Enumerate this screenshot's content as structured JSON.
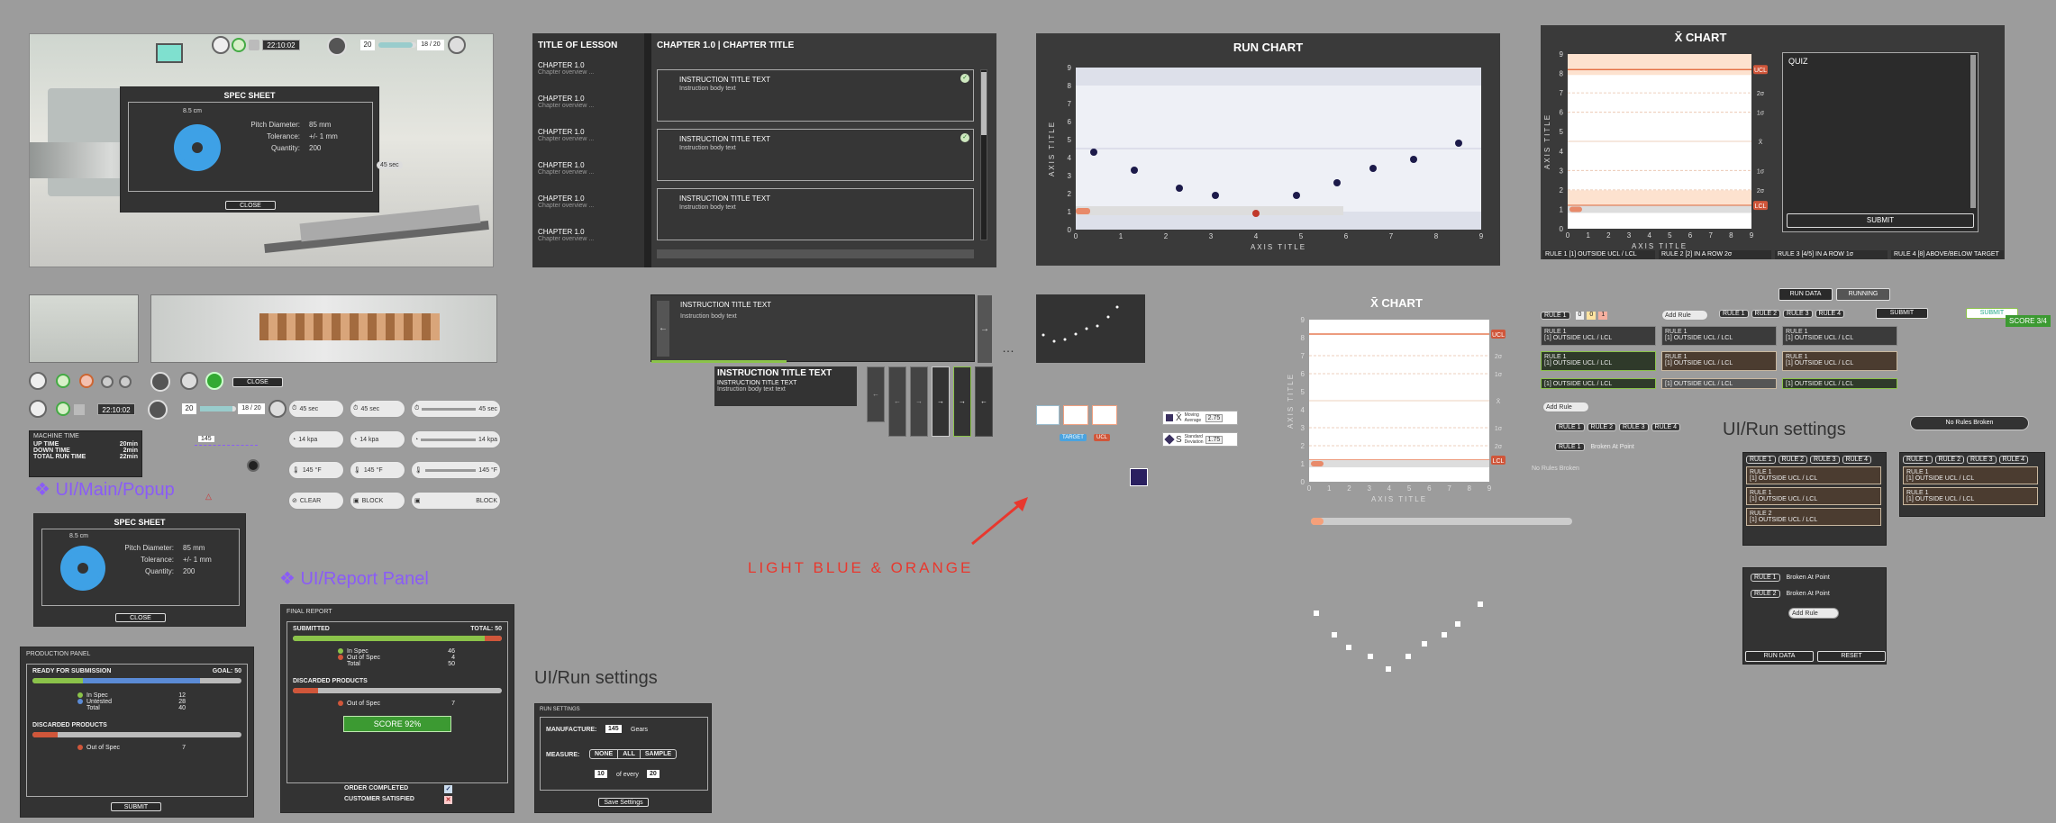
{
  "spec_sheet": {
    "title": "SPEC SHEET",
    "dimension": "8.5 cm",
    "rows": [
      {
        "label": "Pitch Diameter:",
        "value": "85 mm"
      },
      {
        "label": "Tolerance:",
        "value": "+/- 1 mm"
      },
      {
        "label": "Quantity:",
        "value": "200"
      }
    ],
    "close": "CLOSE",
    "badge": "45 sec"
  },
  "top_hud": {
    "time": "22:10:02",
    "count": "20",
    "progress": "18 / 20"
  },
  "lesson": {
    "title": "TITLE OF LESSON",
    "chapter_heading": "CHAPTER 1.0 | CHAPTER TITLE",
    "chapters": [
      {
        "title": "CHAPTER 1.0",
        "sub": "Chapter overview ..."
      },
      {
        "title": "CHAPTER 1.0",
        "sub": "Chapter overview ..."
      },
      {
        "title": "CHAPTER 1.0",
        "sub": "Chapter overview ..."
      },
      {
        "title": "CHAPTER 1.0",
        "sub": "Chapter overview ..."
      },
      {
        "title": "CHAPTER 1.0",
        "sub": "Chapter overview ..."
      },
      {
        "title": "CHAPTER 1.0",
        "sub": "Chapter overview ..."
      }
    ],
    "instructions": [
      {
        "title": "INSTRUCTION TITLE TEXT",
        "body": "Instruction body text",
        "done": true
      },
      {
        "title": "INSTRUCTION TITLE TEXT",
        "body": "Instruction body text",
        "done": true
      },
      {
        "title": "INSTRUCTION TITLE TEXT",
        "body": "Instruction body text",
        "done": false
      }
    ]
  },
  "run_chart": {
    "title": "RUN CHART",
    "xlabel": "AXIS TITLE",
    "ylabel": "AXIS TITLE"
  },
  "xbar_chart": {
    "title": "X̄ CHART",
    "xlabel": "AXIS TITLE",
    "ylabel": "AXIS TITLE",
    "quiz": "QUIZ",
    "submit": "SUBMIT",
    "limits": [
      "UCL",
      "2σ",
      "1σ",
      "X̄",
      "1σ",
      "2σ",
      "LCL"
    ],
    "rules": [
      "RULE 1 [1] OUTSIDE UCL / LCL",
      "RULE 2 [2] IN A ROW 2σ",
      "RULE 3 [4/5] IN A ROW 1σ",
      "RULE 4 [8] ABOVE/BELOW TARGET"
    ]
  },
  "xbar_chart2": {
    "title": "X̄ CHART",
    "xlabel": "AXIS TITLE",
    "ylabel": "AXIS TITLE",
    "limits": [
      "UCL",
      "2σ",
      "1σ",
      "X̄",
      "1σ",
      "2σ",
      "LCL"
    ],
    "no_rules": "No Rules Broken"
  },
  "chart_data": [
    {
      "type": "scatter",
      "title": "RUN CHART",
      "xlabel": "AXIS TITLE",
      "ylabel": "AXIS TITLE",
      "xlim": [
        0,
        9
      ],
      "ylim": [
        0,
        9
      ],
      "x": [
        0.4,
        1.3,
        2.3,
        3.1,
        4,
        4.9,
        5.8,
        6.6,
        7.5,
        8.5
      ],
      "y": [
        4.3,
        3.3,
        2.3,
        1.9,
        0.9,
        1.9,
        2.6,
        3.4,
        3.9,
        4.8
      ]
    },
    {
      "type": "scatter",
      "title": "X̄ CHART",
      "xlabel": "AXIS TITLE",
      "ylabel": "AXIS TITLE",
      "xlim": [
        0,
        9
      ],
      "ylim": [
        0,
        9
      ],
      "x": [],
      "y": []
    }
  ],
  "label_light": "LIGHT BLUE & ORANGE",
  "labels": {
    "main_popup": "❖ UI/Main/Popup",
    "report_panel": "❖ UI/Report Panel",
    "run_settings": "UI/Run settings",
    "run_settings2": "UI/Run settings"
  },
  "machine_time": {
    "title": "MACHINE TIME",
    "rows": [
      {
        "label": "UP TIME",
        "value": "20min"
      },
      {
        "label": "DOWN TIME",
        "value": "2min"
      },
      {
        "label": "TOTAL RUN TIME",
        "value": "22min"
      }
    ]
  },
  "gauges": {
    "time": "45 sec",
    "pressure": "14 kpa",
    "temp": "145 °F",
    "clear": "CLEAR",
    "block": "BLOCK"
  },
  "production": {
    "title": "PRODUCTION PANEL",
    "ready": "READY FOR SUBMISSION",
    "goal": "GOAL: 50",
    "legend": [
      {
        "label": "In Spec",
        "value": "12",
        "color": "#8bc34a"
      },
      {
        "label": "Untested",
        "value": "28",
        "color": "#5b8bd6"
      },
      {
        "label": "Total",
        "value": "40",
        "color": ""
      }
    ],
    "discarded": "DISCARDED PRODUCTS",
    "out": {
      "label": "Out of Spec",
      "value": "7"
    },
    "submit": "SUBMIT"
  },
  "final_report": {
    "title": "FINAL REPORT",
    "submitted": "SUBMITTED",
    "total": "TOTAL: 50",
    "rows": [
      {
        "label": "In Spec",
        "value": "46",
        "color": "#8bc34a"
      },
      {
        "label": "Out of Spec",
        "value": "4",
        "color": "#d0563a"
      },
      {
        "label": "Total",
        "value": "50",
        "color": ""
      }
    ],
    "discarded": "DISCARDED PRODUCTS",
    "out": {
      "label": "Out of Spec",
      "value": "7"
    },
    "score": "SCORE 92%",
    "order": "ORDER COMPLETED",
    "customer": "CUSTOMER SATISFIED"
  },
  "run_settings": {
    "title": "RUN SETTINGS",
    "manufacture": "MANUFACTURE:",
    "qty": "145",
    "item": "Gears",
    "measure": "MEASURE:",
    "options": [
      "NONE",
      "ALL",
      "SAMPLE"
    ],
    "every_a": "10",
    "every_text": "of every",
    "every_b": "20",
    "save": "Save Settings"
  },
  "instr2": {
    "title": "INSTRUCTION TITLE TEXT",
    "body": "Instruction body text",
    "title_big": "INSTRUCTION TITLE TEXT",
    "title2": "INSTRUCTION TITLE TEXT",
    "body2": "Instruction body text text"
  },
  "widgets": {
    "target": "TARGET",
    "ucl": "UCL",
    "moving_avg": "Moving Average",
    "mavg_val": "2.75",
    "std_dev": "Standard Deviation",
    "std_val": "1.75"
  },
  "rules_panel": {
    "run_data": "RUN DATA",
    "running": "RUNNING",
    "submit": "SUBMIT",
    "score": "SCORE 3/4",
    "add_rule": "Add Rule",
    "tabs": [
      "RULE 1",
      "RULE 2",
      "RULE 3",
      "RULE 4"
    ],
    "outside": "[1] OUTSIDE UCL / LCL",
    "rule1": "RULE 1",
    "rule2": "RULE 2",
    "broken_at": "Broken At Point",
    "reset": "RESET",
    "no_rules": "No Rules Broken",
    "score_nums": [
      "0",
      "0",
      "1"
    ]
  }
}
